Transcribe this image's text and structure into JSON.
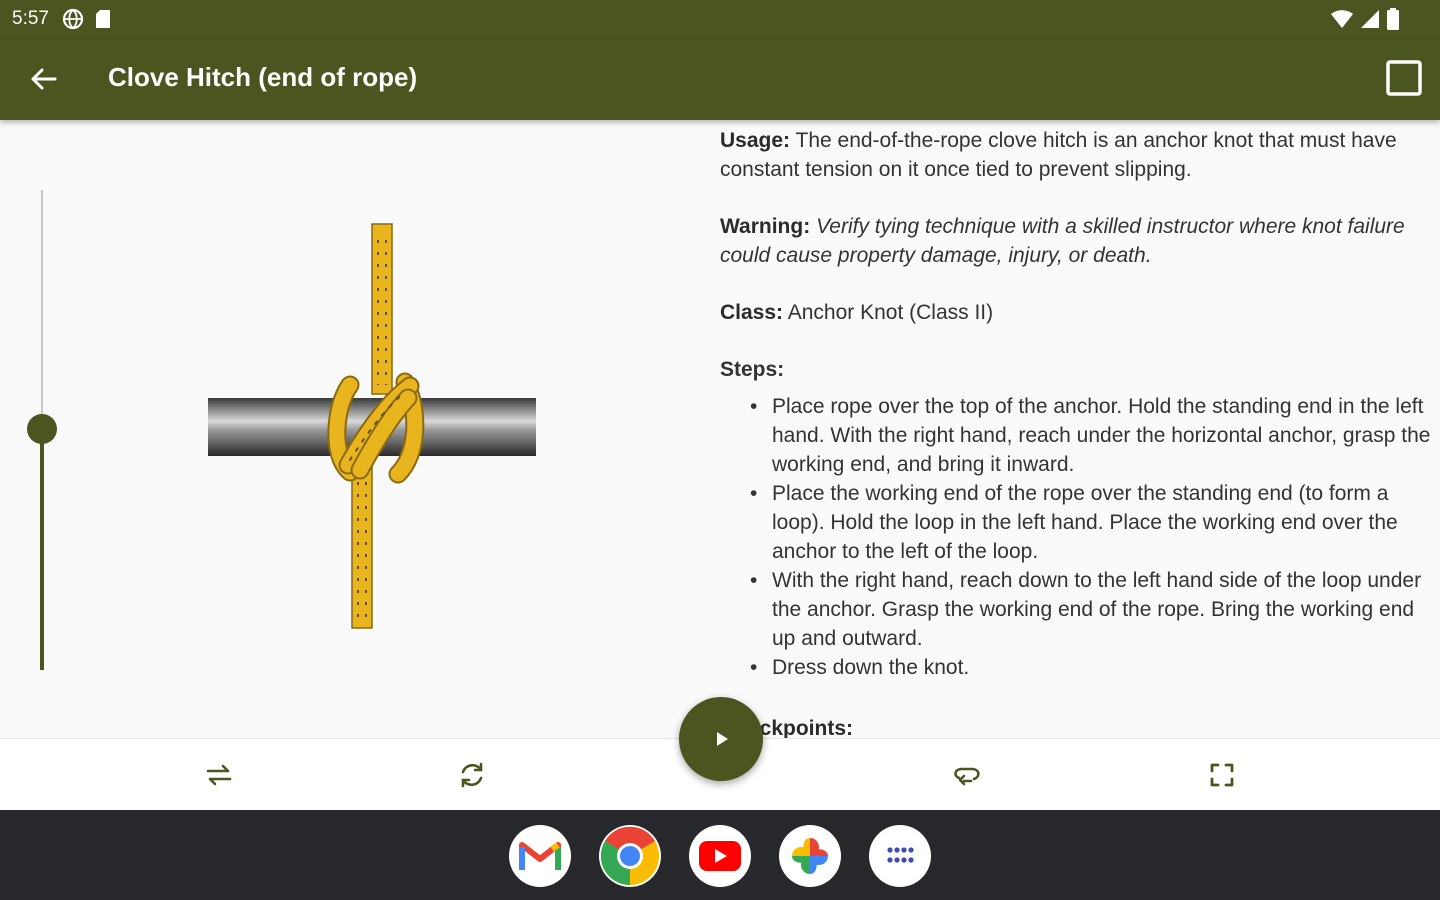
{
  "status": {
    "time": "5:57",
    "icons": [
      "vpn-icon",
      "sd-card-icon",
      "wifi-icon",
      "signal-icon",
      "battery-icon"
    ]
  },
  "appbar": {
    "title": "Clove Hitch (end of rope)",
    "back_icon": "arrow-left-icon",
    "action_icon": "square-outline-icon"
  },
  "slider": {
    "value": 0.5
  },
  "content": {
    "usage_label": "Usage:",
    "usage_text": "The end-of-the-rope clove hitch is an anchor knot that must have constant tension on it once tied to prevent slipping.",
    "warning_label": "Warning:",
    "warning_text": "Verify tying technique with a skilled instructor where knot failure could cause property damage, injury, or death.",
    "class_label": "Class:",
    "class_text": "Anchor Knot (Class II)",
    "steps_label": "Steps:",
    "steps": [
      "Place rope over the top of the anchor. Hold the standing end in the left hand. With the right hand, reach under the horizontal anchor, grasp the working end, and bring it inward.",
      "Place the working end of the rope over the standing end (to form a loop). Hold the loop in the left hand. Place the working end over the anchor to the left of the loop.",
      "With the right hand, reach down to the left hand side of the loop under the anchor. Grasp the working end of the rope. Bring the working end up and outward.",
      "Dress down the knot."
    ],
    "checkpoints_label": "Checkpoints:"
  },
  "toolbar": {
    "buttons": [
      "swap-horizontal-icon",
      "rotate-icon",
      "loop-icon",
      "fullscreen-icon"
    ],
    "play_icon": "play-icon"
  },
  "dock": {
    "apps": [
      "gmail-icon",
      "chrome-icon",
      "youtube-icon",
      "photos-icon",
      "apps-grid-icon"
    ]
  },
  "colors": {
    "primary": "#4a5520",
    "rope": "#e8b51e",
    "dock": "#27282c"
  }
}
